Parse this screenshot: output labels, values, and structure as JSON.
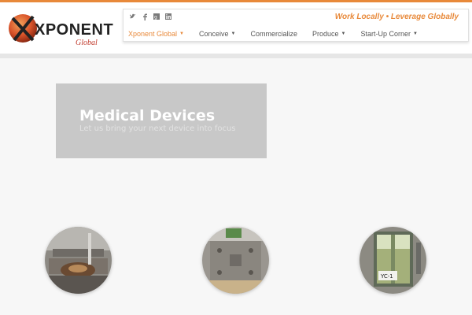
{
  "brand": {
    "name": "XPONENT",
    "sub": "Global",
    "tagline": "Work Locally • Leverage Globally",
    "accent_color": "#e8893a"
  },
  "social": [
    {
      "icon": "twitter-icon",
      "glyph": "❧"
    },
    {
      "icon": "facebook-icon",
      "glyph": "f"
    },
    {
      "icon": "google-plus-icon",
      "glyph": "g"
    },
    {
      "icon": "linkedin-icon",
      "glyph": "in"
    }
  ],
  "nav": [
    {
      "label": "Xponent Global",
      "dropdown": true,
      "active": true
    },
    {
      "label": "Conceive",
      "dropdown": true,
      "active": false
    },
    {
      "label": "Commercialize",
      "dropdown": false,
      "active": false
    },
    {
      "label": "Produce",
      "dropdown": true,
      "active": false
    },
    {
      "label": "Start-Up Corner",
      "dropdown": true,
      "active": false
    }
  ],
  "hero": {
    "title": "Medical Devices",
    "subtitle": "Let us bring your next device into focus"
  },
  "gallery": [
    {
      "name": "gallery-image-1"
    },
    {
      "name": "gallery-image-2"
    },
    {
      "name": "gallery-image-3",
      "label": "YC-1"
    }
  ]
}
